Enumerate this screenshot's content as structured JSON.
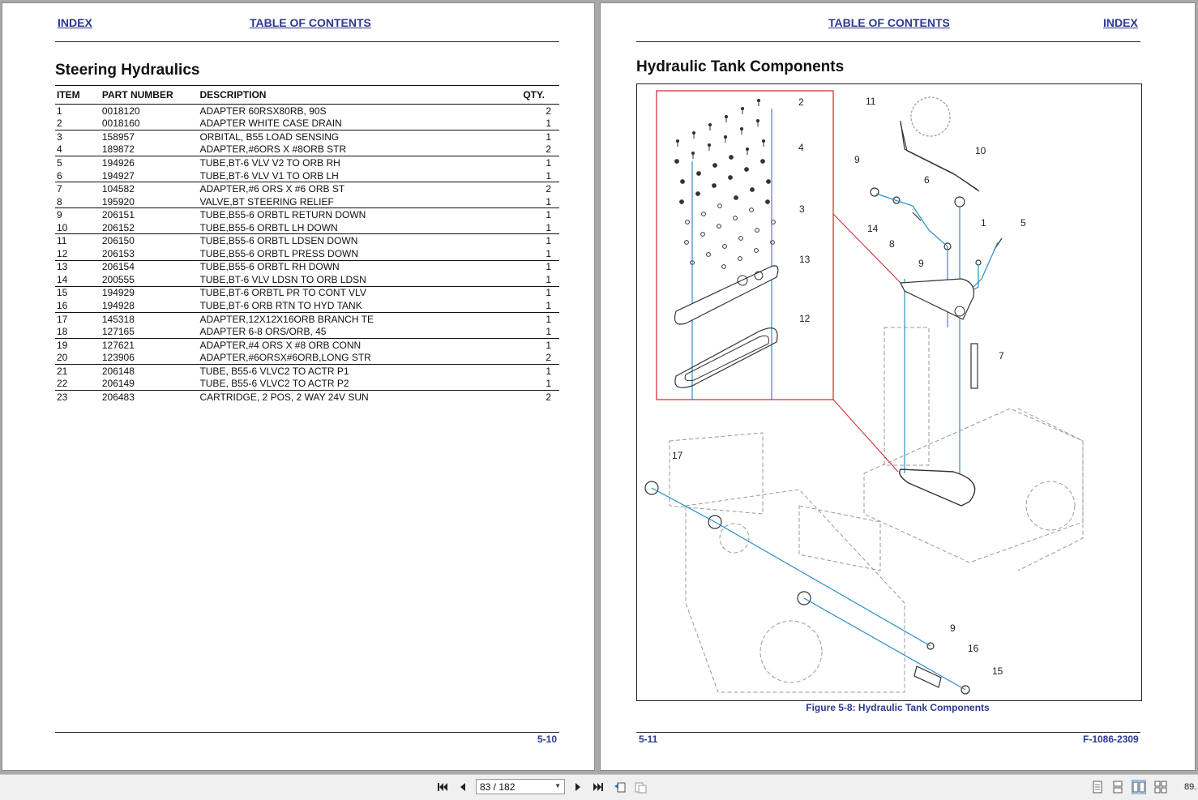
{
  "left_page": {
    "header": {
      "index_link": "INDEX",
      "toc_link": "TABLE OF CONTENTS"
    },
    "title": "Steering Hydraulics",
    "table": {
      "columns": [
        "ITEM",
        "PART NUMBER",
        "DESCRIPTION",
        "QTY."
      ],
      "rows": [
        {
          "item": "1",
          "part": "0018120",
          "desc": "ADAPTER 60RSX80RB, 90S",
          "qty": "2"
        },
        {
          "item": "2",
          "part": "0018160",
          "desc": "ADAPTER WHITE CASE DRAIN",
          "qty": "1"
        },
        {
          "item": "3",
          "part": "158957",
          "desc": "ORBITAL, B55 LOAD SENSING",
          "qty": "1"
        },
        {
          "item": "4",
          "part": "189872",
          "desc": "ADAPTER,#6ORS X #8ORB STR",
          "qty": "2"
        },
        {
          "item": "5",
          "part": "194926",
          "desc": "TUBE,BT-6 VLV V2 TO ORB RH",
          "qty": "1"
        },
        {
          "item": "6",
          "part": "194927",
          "desc": "TUBE,BT-6 VLV V1 TO ORB LH",
          "qty": "1"
        },
        {
          "item": "7",
          "part": "104582",
          "desc": "ADAPTER,#6 ORS X #6 ORB ST",
          "qty": "2"
        },
        {
          "item": "8",
          "part": "195920",
          "desc": "VALVE,BT STEERING RELIEF",
          "qty": "1"
        },
        {
          "item": "9",
          "part": "206151",
          "desc": "TUBE,B55-6 ORBTL RETURN DOWN",
          "qty": "1"
        },
        {
          "item": "10",
          "part": "206152",
          "desc": "TUBE,B55-6 ORBTL LH DOWN",
          "qty": "1"
        },
        {
          "item": "11",
          "part": "206150",
          "desc": "TUBE,B55-6 ORBTL LDSEN DOWN",
          "qty": "1"
        },
        {
          "item": "12",
          "part": "206153",
          "desc": "TUBE,B55-6 ORBTL PRESS DOWN",
          "qty": "1"
        },
        {
          "item": "13",
          "part": "206154",
          "desc": "TUBE,B55-6 ORBTL RH DOWN",
          "qty": "1"
        },
        {
          "item": "14",
          "part": "200555",
          "desc": "TUBE,BT-6 VLV LDSN TO ORB LDSN",
          "qty": "1"
        },
        {
          "item": "15",
          "part": "194929",
          "desc": "TUBE,BT-6 ORBTL PR TO CONT VLV",
          "qty": "1"
        },
        {
          "item": "16",
          "part": "194928",
          "desc": "TUBE,BT-6 ORB RTN TO HYD TANK",
          "qty": "1"
        },
        {
          "item": "17",
          "part": "145318",
          "desc": "ADAPTER,12X12X16ORB BRANCH TE",
          "qty": "1"
        },
        {
          "item": "18",
          "part": "127165",
          "desc": "ADAPTER 6-8 ORS/ORB, 45",
          "qty": "1"
        },
        {
          "item": "19",
          "part": "127621",
          "desc": "ADAPTER,#4 ORS X #8 ORB  CONN",
          "qty": "1"
        },
        {
          "item": "20",
          "part": "123906",
          "desc": "ADAPTER,#6ORSX#6ORB,LONG STR",
          "qty": "2"
        },
        {
          "item": "21",
          "part": "206148",
          "desc": "TUBE, B55-6 VLVC2 TO ACTR P1",
          "qty": "1"
        },
        {
          "item": "22",
          "part": "206149",
          "desc": "TUBE, B55-6 VLVC2 TO ACTR P2",
          "qty": "1"
        },
        {
          "item": "23",
          "part": "206483",
          "desc": "CARTRIDGE, 2 POS, 2 WAY 24V SUN",
          "qty": "2"
        }
      ]
    },
    "page_number": "5-10"
  },
  "right_page": {
    "header": {
      "toc_link": "TABLE OF CONTENTS",
      "index_link": "INDEX"
    },
    "title": "Hydraulic Tank Components",
    "figure": {
      "callouts": [
        "2",
        "4",
        "3",
        "13",
        "12",
        "11",
        "10",
        "9",
        "6",
        "14",
        "8",
        "9",
        "1",
        "5",
        "7",
        "17",
        "9",
        "16",
        "15"
      ]
    },
    "caption": "Figure 5-8:  Hydraulic Tank Components",
    "page_number": "5-11",
    "doc_number": "F-1086-2309"
  },
  "toolbar": {
    "page_field": "83 / 182",
    "zoom": "89.",
    "icons": [
      "first-page-icon",
      "prev-page-icon",
      "next-page-icon",
      "last-page-icon",
      "previous-view-icon",
      "next-view-icon",
      "single-page-icon",
      "continuous-icon",
      "two-page-icon",
      "two-page-continuous-icon"
    ]
  }
}
